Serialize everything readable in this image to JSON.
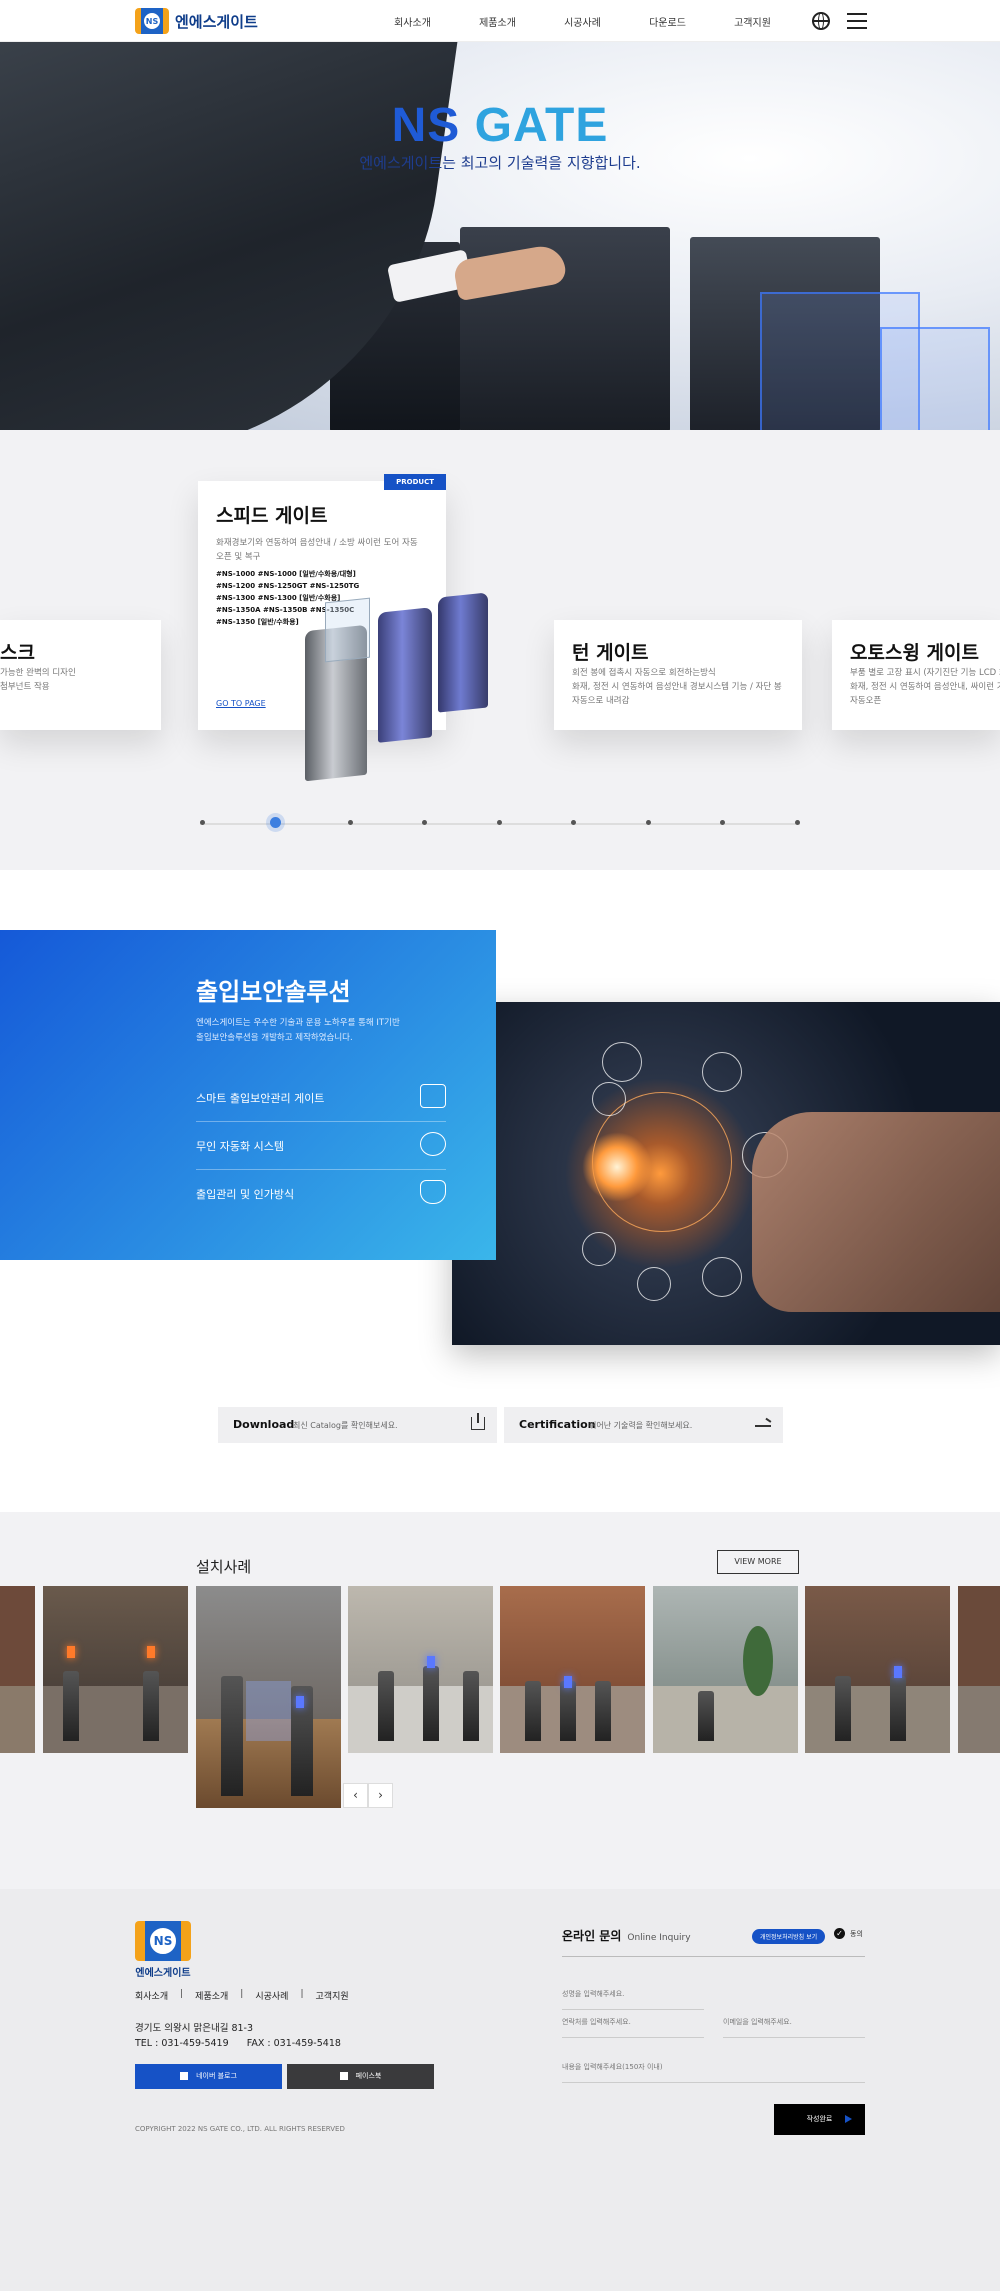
{
  "header": {
    "logo_text": "엔에스게이트",
    "logo_mark": "NS",
    "nav": [
      "회사소개",
      "제품소개",
      "시공사례",
      "다운로드",
      "고객지원"
    ],
    "icons": [
      "globe-icon",
      "hamburger-menu-icon"
    ]
  },
  "hero": {
    "title_ns": "NS ",
    "title_gate": "GATE",
    "subtitle": "엔에스게이트는 최고의 기술력을 지향합니다."
  },
  "products": {
    "badge": "PRODUCT",
    "left": {
      "title": "스크",
      "desc_1": "가능한 완벽의 디자인",
      "desc_2": "첨부넌트 작용"
    },
    "main": {
      "title": "스피드 게이트",
      "desc_1": "화재경보기와 연동하여 음성안내 / 소방 싸이런 도어 자동",
      "desc_2": "오픈 및 복구",
      "models": [
        "#NS-1000  #NS-1000 [일반/수화용/대형]",
        "#NS-1200  #NS-1250GT  #NS-1250TG",
        "#NS-1300  #NS-1300 [일반/수화용]",
        "#NS-1350A  #NS-1350B  #NS-1350C",
        "#NS-1350 [일반/수화용]"
      ],
      "link": "GO TO PAGE"
    },
    "turn": {
      "title": "턴 게이트",
      "desc_1": "회전 봉에 접촉시 자동으로 회전하는방식",
      "desc_2": "화재, 정전 시 연동하여 음성안내 경보시스템 기능 / 자단 봉",
      "desc_3": "자동으로 내려감"
    },
    "swing": {
      "title": "오토스윙 게이트",
      "desc_1": "부품 별로 고장 표시 (자기진단 기능 LCD 화",
      "desc_2": "화재, 정전 시 연동하여 음성안내, 싸이런 기",
      "desc_3": "자동오픈"
    },
    "slide_count": 9,
    "active_slide": 2
  },
  "security": {
    "title": "출입보안솔루션",
    "desc_1": "엔에스게이트는 우수한 기술과 운용 노하우를 통해 IT기반",
    "desc_2": "출입보안솔루션을 개발하고 제작하였습니다.",
    "items": [
      {
        "label": "스마트 출입보안관리 게이트",
        "icon": "card-reader-icon"
      },
      {
        "label": "무인 자동화 시스템",
        "icon": "gear-icon"
      },
      {
        "label": "출입관리 및 인가방식",
        "icon": "touch-hand-icon"
      }
    ]
  },
  "download": {
    "label": "Download",
    "desc": "최신 Catalog를 확인해보세요.",
    "icon": "download-icon"
  },
  "certification": {
    "label": "Certification",
    "desc": "뛰어난 기술력을 확인해보세요.",
    "icon": "arrow-right-icon"
  },
  "install": {
    "title": "설치사례",
    "view_more": "VIEW MORE",
    "prev": "‹",
    "next": "›"
  },
  "footer": {
    "logo_mark": "NS",
    "logo_text": "엔에스게이트",
    "menu": [
      "회사소개",
      "제품소개",
      "시공사례",
      "고객지원"
    ],
    "menu_sep": "|",
    "address": "경기도 의왕시 맑은내길 81-3",
    "tel": "TEL : 031-459-5419",
    "fax": "FAX : 031-459-5418",
    "blog_button": "네이버 블로그",
    "facebook_button": "페이스북",
    "copyright": "COPYRIGHT 2022 NS GATE CO., LTD. ALL RIGHTS RESERVED",
    "inquiry": {
      "title": "온라인 문의",
      "subtitle": "Online Inquiry",
      "policy_button": "개인정보처리방침 보기",
      "agree_label": "동의",
      "name_placeholder": "성명을 입력해주세요.",
      "phone_placeholder": "연락처를 입력해주세요.",
      "email_placeholder": "이메일을 입력해주세요.",
      "content_placeholder": "내용을 입력해주세요(150자 이내)",
      "submit": "작성완료"
    }
  }
}
